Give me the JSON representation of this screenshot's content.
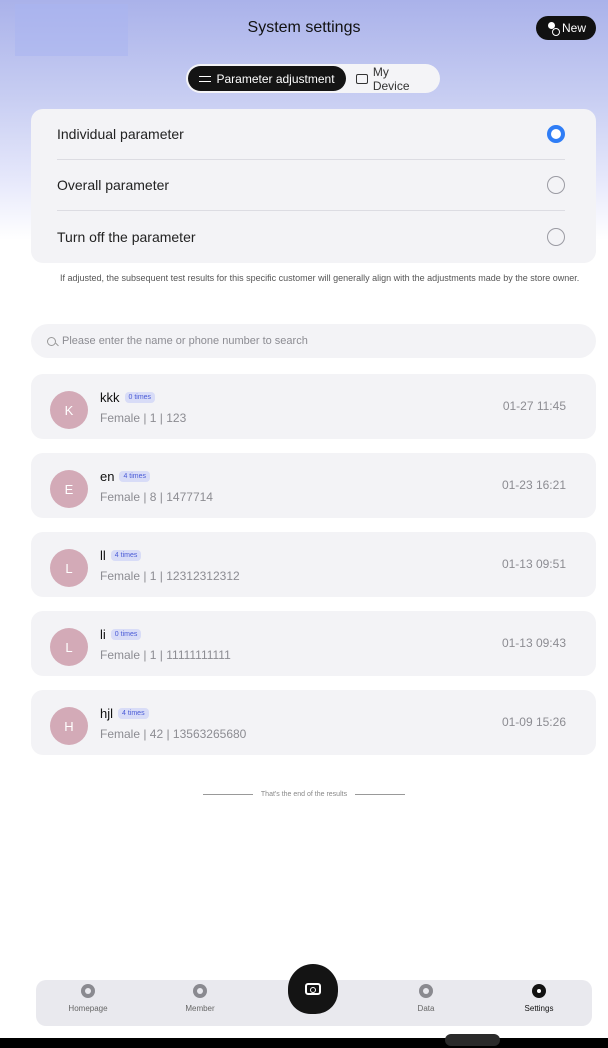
{
  "header": {
    "title": "System settings",
    "new_label": "New"
  },
  "tabs": {
    "parameter_adjustment": "Parameter adjustment",
    "my_device": "My Device"
  },
  "params": {
    "options": [
      {
        "label": "Individual parameter",
        "selected": true
      },
      {
        "label": "Overall parameter",
        "selected": false
      },
      {
        "label": "Turn off the parameter",
        "selected": false
      }
    ],
    "note": "If adjusted, the subsequent test results for this specific customer will generally align with the adjustments made by the store owner."
  },
  "search": {
    "placeholder": "Please enter the name or phone number to search"
  },
  "customers": [
    {
      "initial": "K",
      "name": "kkk",
      "badge": "0 times",
      "info": "Female | 1 | 123",
      "time": "01-27 11:45"
    },
    {
      "initial": "E",
      "name": "en",
      "badge": "4 times",
      "info": "Female | 8 | 1477714",
      "time": "01-23 16:21"
    },
    {
      "initial": "L",
      "name": "ll",
      "badge": "4 times",
      "info": "Female | 1 | 12312312312",
      "time": "01-13 09:51"
    },
    {
      "initial": "L",
      "name": "li",
      "badge": "0 times",
      "info": "Female | 1 | 11111111111",
      "time": "01-13 09:43"
    },
    {
      "initial": "H",
      "name": "hjl",
      "badge": "4 times",
      "info": "Female | 42 | 13563265680",
      "time": "01-09 15:26"
    }
  ],
  "end_text": "That's the end of the results",
  "nav": {
    "homepage": "Homepage",
    "member": "Member",
    "data": "Data",
    "settings": "Settings"
  },
  "colors": {
    "accent": "#2f7df6",
    "avatar": "#d3aab7",
    "badge_text": "#4a5bd6"
  }
}
